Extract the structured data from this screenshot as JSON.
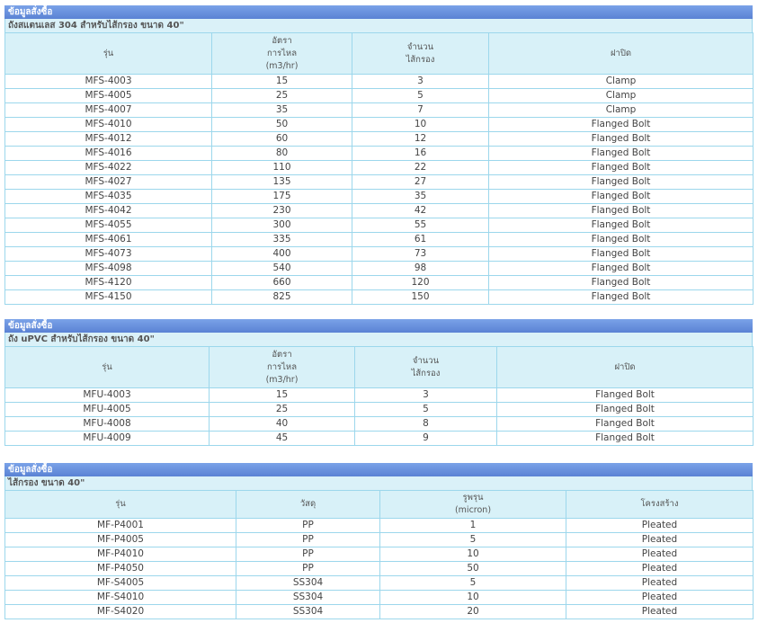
{
  "section1": {
    "title": "ข้อมูลสั่งซื้อ",
    "subtitle": "ถังสแตนเลส 304 สำหรับไส้กรอง ขนาด 40\"",
    "headers": [
      [
        "รุ่น"
      ],
      [
        "อัตรา",
        "การไหล",
        "(m3/hr)"
      ],
      [
        "จำนวน",
        "ไส้กรอง"
      ],
      [
        "ฝาปิด"
      ]
    ],
    "rows": [
      [
        "MFS-4003",
        "15",
        "3",
        "Clamp"
      ],
      [
        "MFS-4005",
        "25",
        "5",
        "Clamp"
      ],
      [
        "MFS-4007",
        "35",
        "7",
        "Clamp"
      ],
      [
        "MFS-4010",
        "50",
        "10",
        "Flanged Bolt"
      ],
      [
        "MFS-4012",
        "60",
        "12",
        "Flanged Bolt"
      ],
      [
        "MFS-4016",
        "80",
        "16",
        "Flanged Bolt"
      ],
      [
        "MFS-4022",
        "110",
        "22",
        "Flanged Bolt"
      ],
      [
        "MFS-4027",
        "135",
        "27",
        "Flanged Bolt"
      ],
      [
        "MFS-4035",
        "175",
        "35",
        "Flanged Bolt"
      ],
      [
        "MFS-4042",
        "230",
        "42",
        "Flanged Bolt"
      ],
      [
        "MFS-4055",
        "300",
        "55",
        "Flanged Bolt"
      ],
      [
        "MFS-4061",
        "335",
        "61",
        "Flanged Bolt"
      ],
      [
        "MFS-4073",
        "400",
        "73",
        "Flanged Bolt"
      ],
      [
        "MFS-4098",
        "540",
        "98",
        "Flanged Bolt"
      ],
      [
        "MFS-4120",
        "660",
        "120",
        "Flanged Bolt"
      ],
      [
        "MFS-4150",
        "825",
        "150",
        "Flanged Bolt"
      ]
    ]
  },
  "section2": {
    "title": "ข้อมูลสั่งซื้อ",
    "subtitle": "ถัง uPVC สำหรับไส้กรอง ขนาด 40\"",
    "headers": [
      [
        "รุ่น"
      ],
      [
        "อัตรา",
        "การไหล",
        "(m3/hr)"
      ],
      [
        "จำนวน",
        "ไส้กรอง"
      ],
      [
        "ฝาปิด"
      ]
    ],
    "rows": [
      [
        "MFU-4003",
        "15",
        "3",
        "Flanged Bolt"
      ],
      [
        "MFU-4005",
        "25",
        "5",
        "Flanged Bolt"
      ],
      [
        "MFU-4008",
        "40",
        "8",
        "Flanged Bolt"
      ],
      [
        "MFU-4009",
        "45",
        "9",
        "Flanged Bolt"
      ]
    ]
  },
  "section3": {
    "title": "ข้อมูลสั่งซื้อ",
    "subtitle": "ไส้กรอง ขนาด 40\"",
    "headers": [
      [
        "รุ่น"
      ],
      [
        "วัสดุ"
      ],
      [
        "รูพรุน",
        "(micron)"
      ],
      [
        "โครงสร้าง"
      ]
    ],
    "rows": [
      [
        "MF-P4001",
        "PP",
        "1",
        "Pleated"
      ],
      [
        "MF-P4005",
        "PP",
        "5",
        "Pleated"
      ],
      [
        "MF-P4010",
        "PP",
        "10",
        "Pleated"
      ],
      [
        "MF-P4050",
        "PP",
        "50",
        "Pleated"
      ],
      [
        "MF-S4005",
        "SS304",
        "5",
        "Pleated"
      ],
      [
        "MF-S4010",
        "SS304",
        "10",
        "Pleated"
      ],
      [
        "MF-S4020",
        "SS304",
        "20",
        "Pleated"
      ]
    ]
  },
  "colors": {
    "title_bar": "#6a92de",
    "sub_bar": "#daf1f8",
    "header_bg": "#d8f1f8",
    "border": "#9cd7ec"
  }
}
